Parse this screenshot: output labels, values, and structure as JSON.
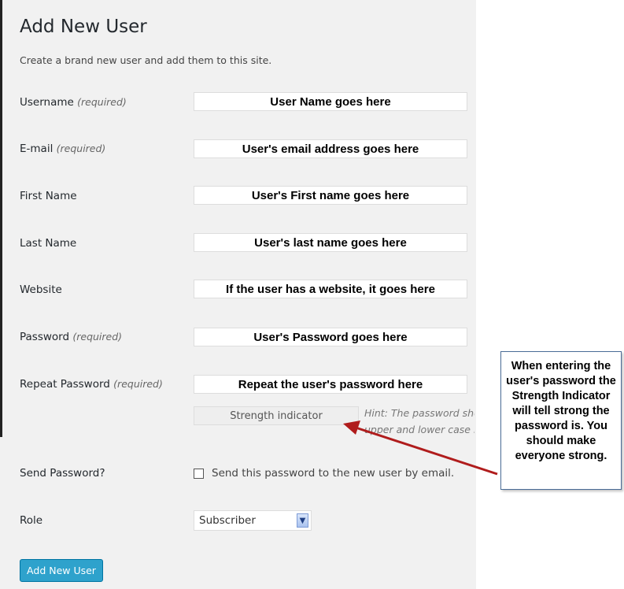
{
  "page": {
    "title": "Add New User",
    "description": "Create a brand new user and add them to this site."
  },
  "fields": {
    "username": {
      "label": "Username",
      "required": "(required)",
      "value": "User Name goes here"
    },
    "email": {
      "label": "E-mail",
      "required": "(required)",
      "value": "User's email address goes here"
    },
    "first_name": {
      "label": "First Name",
      "value": "User's First name goes here"
    },
    "last_name": {
      "label": "Last Name",
      "value": "User's last name goes here"
    },
    "website": {
      "label": "Website",
      "value": "If the user has a website, it goes here"
    },
    "password": {
      "label": "Password",
      "required": "(required)",
      "value": "User's Password goes here"
    },
    "repeat_password": {
      "label": "Repeat Password",
      "required": "(required)",
      "value": "Repeat the user's password here"
    }
  },
  "strength": {
    "label": "Strength indicator",
    "hint_line1": "Hint: The password sho",
    "hint_line2": "upper and lower case l"
  },
  "send_password": {
    "label": "Send Password?",
    "checkbox_label": "Send this password to the new user by email.",
    "checked": false
  },
  "role": {
    "label": "Role",
    "selected": "Subscriber"
  },
  "submit": {
    "label": "Add New User"
  },
  "callout": {
    "text": "When entering the user's password the Strength Indicator will tell strong the password is.  You should make everyone strong."
  },
  "colors": {
    "panel": "#f1f1f1",
    "button": "#2ea2cc",
    "arrow": "#b01c1c",
    "callout_border": "#4a6c96"
  },
  "icons": {
    "select_arrow": "chevron-down-icon",
    "callout_arrow": "arrow-icon"
  }
}
